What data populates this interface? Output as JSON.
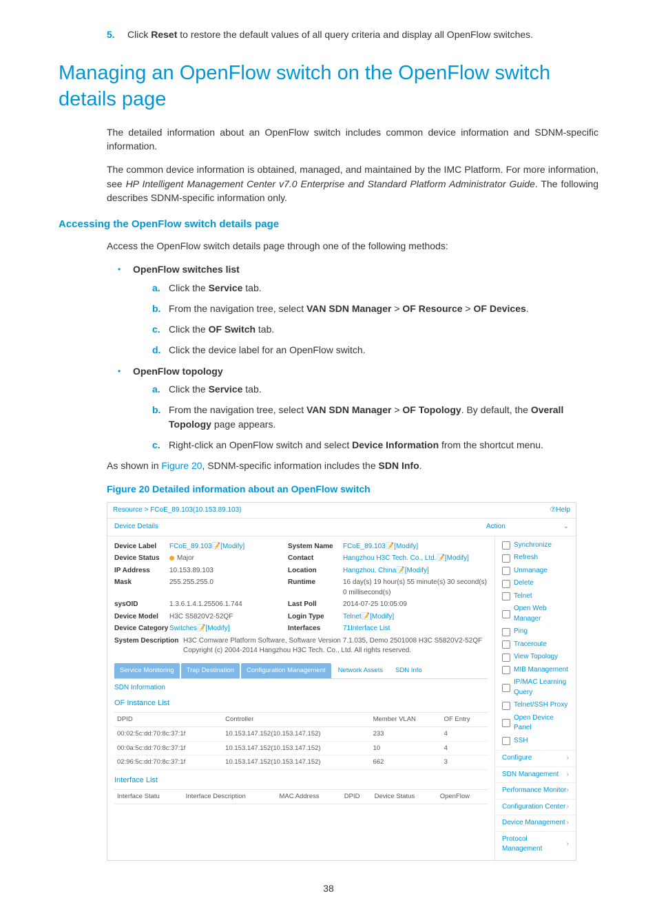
{
  "step5": {
    "num": "5.",
    "text_before": "Click ",
    "bold": "Reset",
    "text_after": " to restore the default values of all query criteria and display all OpenFlow switches."
  },
  "h1": "Managing an OpenFlow switch on the OpenFlow switch details page",
  "para1": "The detailed information about an OpenFlow switch includes common device information and SDNM-specific information.",
  "para2_a": "The common device information is obtained, managed, and maintained by the IMC Platform. For more information, see ",
  "para2_i": "HP Intelligent Management Center v7.0 Enterprise and Standard Platform Administrator Guide",
  "para2_b": ". The following describes SDNM-specific information only.",
  "h2a": "Accessing the OpenFlow switch details page",
  "para3": "Access the OpenFlow switch details page through one of the following methods:",
  "list": {
    "item1": {
      "head": "OpenFlow switches list",
      "a": {
        "pre": "Click the ",
        "b": "Service",
        "post": " tab."
      },
      "b": {
        "pre": "From the navigation tree, select ",
        "b1": "VAN SDN Manager",
        "sep": " > ",
        "b2": "OF Resource",
        "b3": "OF Devices",
        "post": "."
      },
      "c": {
        "pre": "Click the ",
        "b": "OF Switch",
        "post": " tab."
      },
      "d": {
        "txt": "Click the device label for an OpenFlow switch."
      }
    },
    "item2": {
      "head": "OpenFlow topology",
      "a": {
        "pre": "Click the ",
        "b": "Service",
        "post": " tab."
      },
      "b": {
        "pre": "From the navigation tree, select ",
        "b1": "VAN SDN Manager",
        "sep": " > ",
        "b2": "OF Topology",
        "post": ". By default, the ",
        "b3": "Overall Topology",
        "post2": " page appears."
      },
      "c": {
        "pre": "Right-click an OpenFlow switch and select ",
        "b": "Device Information",
        "post": " from the shortcut menu."
      }
    }
  },
  "para4_a": "As shown in ",
  "para4_link": "Figure 20",
  "para4_b": ", SDNM-specific information includes the ",
  "para4_bold": "SDN Info",
  "para4_c": ".",
  "figcap": "Figure 20 Detailed information about an OpenFlow switch",
  "fig": {
    "breadcrumb": "Resource > FCoE_89.103(10.153.89.103)",
    "help": "⑦Help",
    "device_details": "Device Details",
    "action": "Action",
    "rows": [
      {
        "k1": "Device Label",
        "v1": "FCoE_89.103📝[Modify]",
        "k2": "System Name",
        "v2": "FCoE_89.103📝[Modify]"
      },
      {
        "k1": "Device Status",
        "v1": "Major",
        "k2": "Contact",
        "v2": "Hangzhou H3C Tech. Co., Ltd.📝[Modify]"
      },
      {
        "k1": "IP Address",
        "v1": "10.153.89.103",
        "k2": "Location",
        "v2": "Hangzhou, China📝[Modify]"
      },
      {
        "k1": "Mask",
        "v1": "255.255.255.0",
        "k2": "Runtime",
        "v2": "16 day(s) 19 hour(s) 55 minute(s) 30 second(s) 0 millisecond(s)"
      },
      {
        "k1": "sysOID",
        "v1": "1.3.6.1.4.1.25506.1.744",
        "k2": "Last Poll",
        "v2": "2014-07-25 10:05:09"
      },
      {
        "k1": "Device Model",
        "v1": "H3C S5820V2-52QF",
        "k2": "Login Type",
        "v2": "Telnet📝[Modify]"
      },
      {
        "k1": "Device Category",
        "v1": "Switches📝[Modify]",
        "k2": "Interfaces",
        "v2": "71Interface List"
      }
    ],
    "sysdesc_k": "System Description",
    "sysdesc_v": "H3C Comware Platform Software, Software Version 7.1.035, Demo 2501008 H3C S5820V2-52QF Copyright (c) 2004-2014 Hangzhou H3C Tech. Co., Ltd. All rights reserved.",
    "tabs": [
      "Service Monitoring",
      "Trap Destination",
      "Configuration Management",
      "Network Assets",
      "SDN Info"
    ],
    "sdn_info": "SDN Information",
    "of_instance": "OF Instance List",
    "cols1": [
      "DPID",
      "Controller",
      "Member VLAN",
      "OF Entry"
    ],
    "rows1": [
      [
        "00:02:5c:dd:70:8c:37:1f",
        "10.153.147.152(10.153.147.152)",
        "233",
        "4"
      ],
      [
        "00:0a:5c:dd:70:8c:37:1f",
        "10.153.147.152(10.153.147.152)",
        "10",
        "4"
      ],
      [
        "02:96:5c:dd:70:8c:37:1f",
        "10.153.147.152(10.153.147.152)",
        "662",
        "3"
      ]
    ],
    "iface_list": "Interface List",
    "cols2": [
      "Interface Statu",
      "Interface Description",
      "MAC Address",
      "DPID",
      "Device Status",
      "OpenFlow"
    ],
    "actions": [
      "Synchronize",
      "Refresh",
      "Unmanage",
      "Delete",
      "Telnet",
      "Open Web Manager",
      "Ping",
      "Traceroute",
      "View Topology",
      "MIB Management",
      "IP/MAC Learning Query",
      "Telnet/SSH Proxy",
      "Open Device Panel",
      "SSH"
    ],
    "cfg": [
      "Configure",
      "SDN Management",
      "Performance Monitor",
      "Configuration Center",
      "Device Management",
      "Protocol Management"
    ]
  },
  "pagenum": "38"
}
